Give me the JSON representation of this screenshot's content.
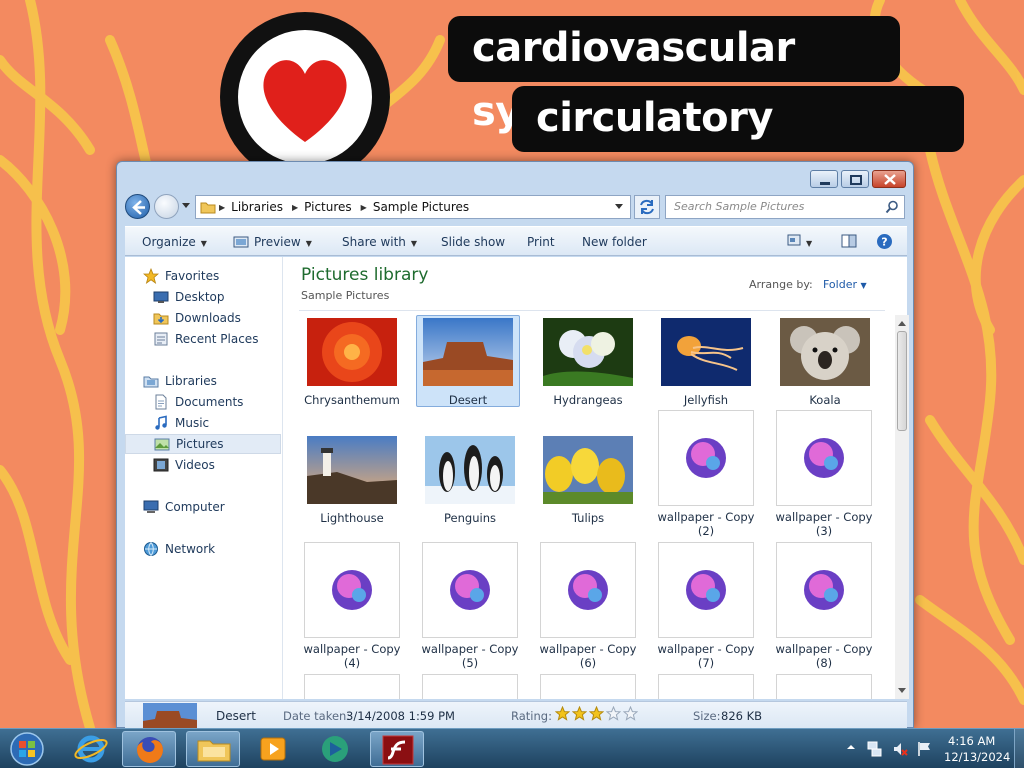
{
  "wallpaper": {
    "banner_line1": "cardiovascular system",
    "banner_line2": "circulatory system",
    "heart_color": "#e0201b",
    "background_color": "#f38a60"
  },
  "window": {
    "breadcrumb": [
      "Libraries",
      "Pictures",
      "Sample Pictures"
    ],
    "search_placeholder": "Search Sample Pictures",
    "toolbar": {
      "organize": "Organize",
      "preview": "Preview",
      "share_with": "Share with",
      "slide_show": "Slide show",
      "print": "Print",
      "new_folder": "New folder"
    },
    "nav": {
      "favorites": "Favorites",
      "desktop": "Desktop",
      "downloads": "Downloads",
      "recent_places": "Recent Places",
      "libraries": "Libraries",
      "documents": "Documents",
      "music": "Music",
      "pictures": "Pictures",
      "videos": "Videos",
      "computer": "Computer",
      "network": "Network"
    },
    "library_title": "Pictures library",
    "library_subtitle": "Sample Pictures",
    "arrange_label": "Arrange by:",
    "arrange_value": "Folder",
    "files": [
      {
        "name": "Chrysanthemum",
        "kind": "photo"
      },
      {
        "name": "Desert",
        "kind": "photo",
        "selected": true
      },
      {
        "name": "Hydrangeas",
        "kind": "photo"
      },
      {
        "name": "Jellyfish",
        "kind": "photo"
      },
      {
        "name": "Koala",
        "kind": "photo"
      },
      {
        "name": "Lighthouse",
        "kind": "photo"
      },
      {
        "name": "Penguins",
        "kind": "photo"
      },
      {
        "name": "Tulips",
        "kind": "photo"
      },
      {
        "name": "wallpaper - Copy (2)",
        "kind": "wallpaper"
      },
      {
        "name": "wallpaper - Copy (3)",
        "kind": "wallpaper"
      },
      {
        "name": "wallpaper - Copy (4)",
        "kind": "wallpaper"
      },
      {
        "name": "wallpaper - Copy (5)",
        "kind": "wallpaper"
      },
      {
        "name": "wallpaper - Copy (6)",
        "kind": "wallpaper"
      },
      {
        "name": "wallpaper - Copy (7)",
        "kind": "wallpaper"
      },
      {
        "name": "wallpaper - Copy (8)",
        "kind": "wallpaper"
      }
    ],
    "details": {
      "name": "Desert",
      "date_label": "Date taken:",
      "date_value": "3/14/2008 1:59 PM",
      "rating_label": "Rating:",
      "rating_stars": 3,
      "rating_max": 5,
      "size_label": "Size:",
      "size_value": "826 KB"
    }
  },
  "taskbar": {
    "time": "4:16 AM",
    "date": "12/13/2024",
    "pinned": [
      "start-orb-icon",
      "internet-explorer-icon",
      "firefox-icon",
      "windows-explorer-icon",
      "media-player-icon",
      "app-icon",
      "flash-icon"
    ]
  }
}
